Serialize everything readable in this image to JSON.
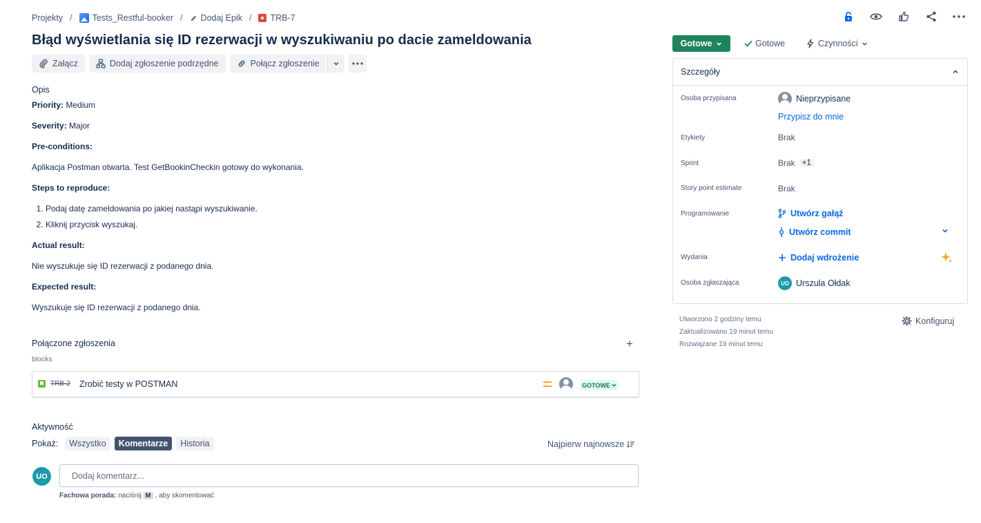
{
  "breadcrumb": {
    "projects": "Projekty",
    "project": "Tests_Restful-booker",
    "epic": "Dodaj Epik",
    "issue_key": "TRB-7",
    "separator": "/"
  },
  "issue": {
    "title": "Błąd wyświetlania się ID rezerwacji w wyszukiwaniu po dacie zameldowania"
  },
  "toolbar": {
    "attach": "Załącz",
    "add_child": "Dodaj zgłoszenie podrzędne",
    "link_issue": "Połącz zgłoszenie"
  },
  "description": {
    "label": "Opis",
    "priority_label": "Priority:",
    "priority_value": " Medium",
    "severity_label": "Severity:",
    "severity_value": " Major",
    "preconditions_label": "Pre-conditions:",
    "preconditions_text": "Aplikacja Postman otwarta. Test GetBookinCheckin gotowy do wykonania.",
    "steps_label": "Steps to reproduce:",
    "steps": [
      "Podaj datę zameldowania po jakiej nastąpi wyszukiwanie.",
      "Kliknij przycisk wyszukaj."
    ],
    "actual_label": "Actual result:",
    "actual_text": "Nie wyszukuje się ID rezerwacji z podanego dnia.",
    "expected_label": "Expected result:",
    "expected_text": "Wyszukuje się ID rezerwacji z podanego dnia."
  },
  "linked": {
    "title": "Połączone zgłoszenia",
    "add": "+",
    "relation": "blocks",
    "item": {
      "key": "TRB-2",
      "summary": "Zrobić testy w POSTMAN",
      "status": "GOTOWE"
    }
  },
  "activity": {
    "title": "Aktywność",
    "show_label": "Pokaż:",
    "filters": [
      "Wszystko",
      "Komentarze",
      "Historia"
    ],
    "active_filter": "Komentarze",
    "sort": "Najpierw najnowsze",
    "avatar_initials": "UO",
    "comment_placeholder": "Dodaj komentarz...",
    "tip_bold": "Fachowa porada:",
    "tip_pre": " naciśnij ",
    "tip_key": "M",
    "tip_post": ", aby skomentować"
  },
  "status": {
    "button": "Gotowe",
    "done": "Gotowe",
    "actions": "Czynności"
  },
  "details": {
    "header": "Szczegóły",
    "assignee_label": "Osoba przypisana",
    "assignee_value": "Nieprzypisane",
    "assign_to_me": "Przypisz do mnie",
    "labels_label": "Etykiety",
    "labels_value": "Brak",
    "sprint_label": "Sprint",
    "sprint_value": "Brak",
    "sprint_extra": "+1",
    "story_points_label": "Story point estimate",
    "story_points_value": "Brak",
    "dev_label": "Programowanie",
    "create_branch": "Utwórz gałąź",
    "create_commit": "Utwórz commit",
    "releases_label": "Wydania",
    "add_deployment": "Dodaj wdrożenie",
    "reporter_label": "Osoba zgłaszająca",
    "reporter_initials": "UO",
    "reporter_value": "Urszula Ołdak"
  },
  "meta": {
    "created": "Utworzono 2 godziny temu",
    "updated": "Zaktualizowano 19 minut temu",
    "resolved": "Rozwiązane 19 minut temu",
    "configure": "Konfiguruj"
  },
  "colors": {
    "status_green": "#1f845a",
    "link_blue": "#0c66e4",
    "lozenge_bg": "#dcfff1",
    "priority_medium": "#f5a623"
  }
}
